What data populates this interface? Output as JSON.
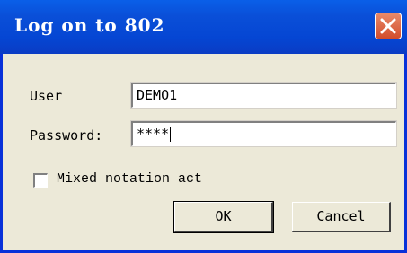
{
  "window": {
    "title": "Log on to 802"
  },
  "form": {
    "user_label": "User",
    "user_value": "DEMO1",
    "password_label": "Password:",
    "password_value": "****",
    "mixed_notation_label": "Mixed notation act",
    "mixed_notation_checked": false
  },
  "buttons": {
    "ok": "OK",
    "cancel": "Cancel"
  },
  "colors": {
    "titlebar": "#0a4fd8",
    "close": "#d24d2c",
    "dialog_bg": "#ece9d8"
  }
}
